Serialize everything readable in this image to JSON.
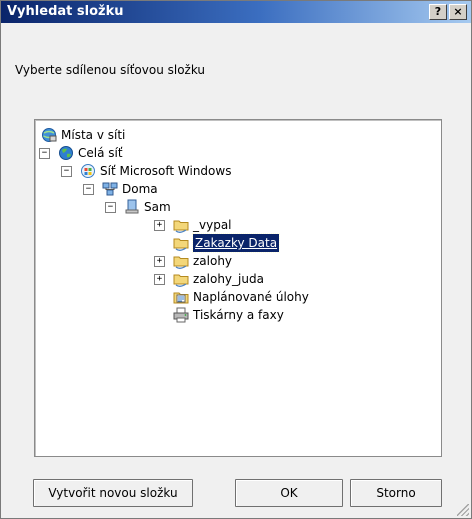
{
  "window": {
    "title": "Vyhledat složku",
    "help_symbol": "?",
    "close_symbol": "×"
  },
  "instruction": "Vyberte sdílenou síťovou složku",
  "tree": {
    "items": [
      {
        "label": "Místa v síti",
        "icon": "network-places-icon",
        "expander": ""
      },
      {
        "label": "Celá síť",
        "icon": "globe-icon",
        "expander": "−"
      },
      {
        "label": "Síť Microsoft Windows",
        "icon": "windows-network-icon",
        "expander": "−"
      },
      {
        "label": "Doma",
        "icon": "workgroup-icon",
        "expander": "−"
      },
      {
        "label": "Sam",
        "icon": "computer-icon",
        "expander": "−"
      },
      {
        "label": "_vypal",
        "icon": "shared-folder-icon",
        "expander": "+"
      },
      {
        "label": "Zakazky Data",
        "icon": "shared-folder-icon",
        "expander": ""
      },
      {
        "label": "zalohy",
        "icon": "shared-folder-icon",
        "expander": "+"
      },
      {
        "label": "zalohy_juda",
        "icon": "shared-folder-icon",
        "expander": "+"
      },
      {
        "label": "Naplánované úlohy",
        "icon": "scheduled-tasks-icon",
        "expander": ""
      },
      {
        "label": "Tiskárny a faxy",
        "icon": "printers-icon",
        "expander": ""
      }
    ],
    "selected": "Zakazky Data"
  },
  "buttons": {
    "new_folder": "Vytvořit novou složku",
    "ok": "OK",
    "cancel": "Storno"
  },
  "colors": {
    "titlebar_start": "#0a246a",
    "titlebar_end": "#a6caf0",
    "selection": "#0a246a"
  }
}
